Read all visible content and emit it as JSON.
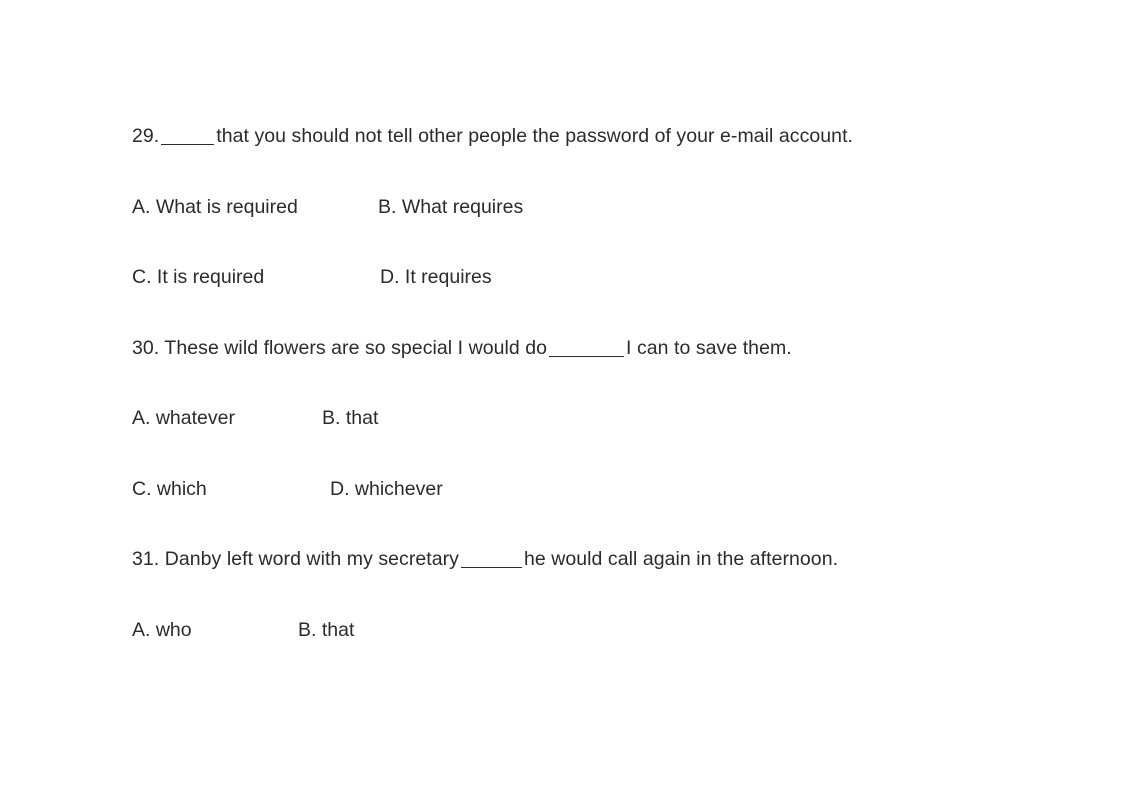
{
  "document": {
    "background_color": "#ffffff",
    "text_color": "#2b2b2b"
  },
  "questions": [
    {
      "number": "29.",
      "stem_before_blank": "",
      "stem_after_blank": "that you should not tell other people the password of your e-mail account.",
      "options": [
        {
          "key": "A",
          "label": "A. What is required"
        },
        {
          "key": "B",
          "label": "B. What requires"
        },
        {
          "key": "C",
          "label": "C. It is required"
        },
        {
          "key": "D",
          "label": "D. It requires"
        }
      ]
    },
    {
      "number": "30.",
      "stem_before_blank": "These wild flowers are so special I would do",
      "stem_after_blank": "I can to save them.",
      "options": [
        {
          "key": "A",
          "label": "A. whatever"
        },
        {
          "key": "B",
          "label": "B. that"
        },
        {
          "key": "C",
          "label": "C. which"
        },
        {
          "key": "D",
          "label": "D. whichever"
        }
      ]
    },
    {
      "number": "31.",
      "stem_before_blank": "Danby left word with my secretary",
      "stem_after_blank": "he would call again in the afternoon.",
      "options": [
        {
          "key": "A",
          "label": "A. who"
        },
        {
          "key": "B",
          "label": "B. that"
        }
      ]
    }
  ]
}
